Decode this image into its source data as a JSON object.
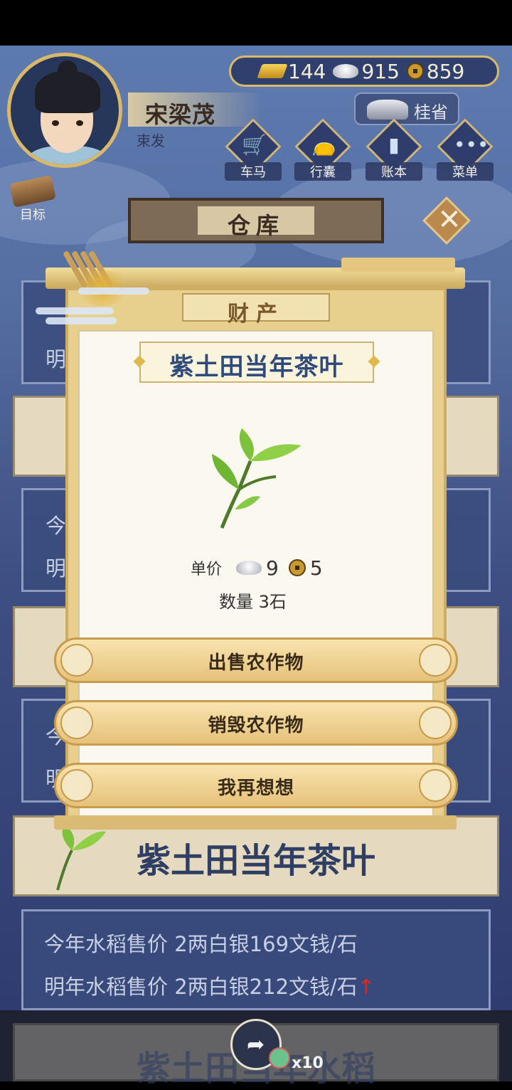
{
  "player": {
    "name": "宋梁茂",
    "subtitle": "束发"
  },
  "currency": {
    "gold": "144",
    "silver": "915",
    "copper": "859"
  },
  "location": {
    "label": "桂省"
  },
  "menu": {
    "items": [
      {
        "label": "车马",
        "icon": "carriage-icon"
      },
      {
        "label": "行囊",
        "icon": "bag-icon"
      },
      {
        "label": "账本",
        "icon": "ledger-icon"
      },
      {
        "label": "菜单",
        "icon": "more-icon"
      }
    ]
  },
  "goal": {
    "label": "目标"
  },
  "warehouse": {
    "title": "仓库"
  },
  "background_list": {
    "partials": [
      "明",
      "今",
      "明",
      "今",
      "明"
    ],
    "item_title": "紫土田当年茶叶",
    "price_this_year": "今年水稻售价 2两白银169文钱/石",
    "price_next_year": "明年水稻售价 2两白银212文钱/石",
    "price_next_year_trend": "↑",
    "next_item_title": "紫土田当年水稻"
  },
  "dialog": {
    "header": "财产",
    "item_name": "紫土田当年茶叶",
    "unit_price_label": "单价",
    "unit_price_silver": "9",
    "unit_price_copper": "5",
    "quantity_text": "数量 3石",
    "buttons": {
      "sell": "出售农作物",
      "destroy": "销毁农作物",
      "reconsider": "我再想想"
    }
  },
  "share": {
    "count": "x10"
  },
  "colors": {
    "accent_gold": "#d9b969",
    "title_blue": "#2f4b7c",
    "price_up": "#e3261b"
  }
}
